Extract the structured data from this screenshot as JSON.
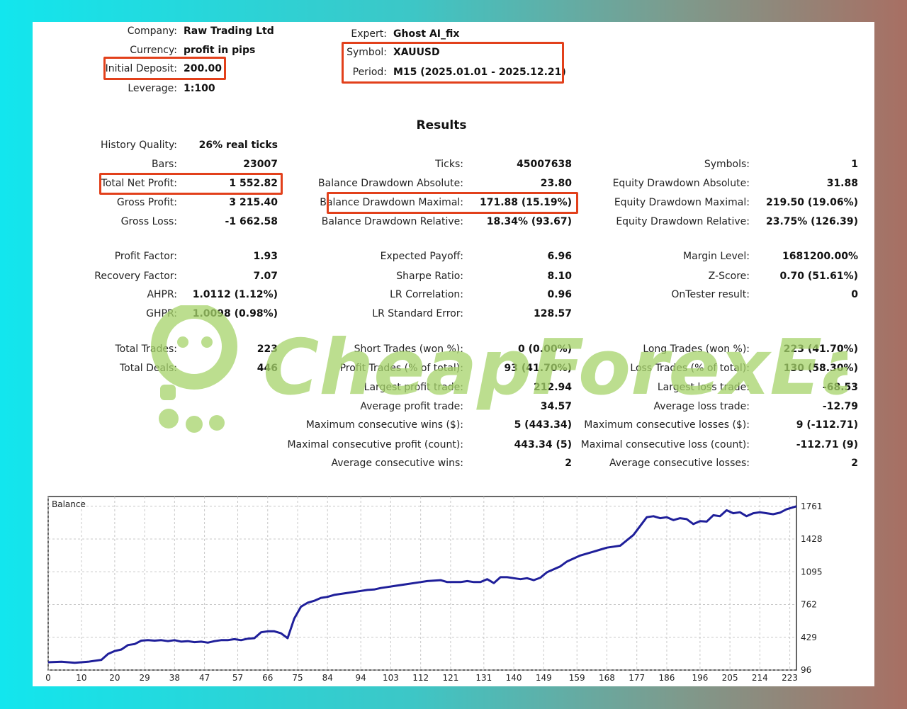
{
  "header": {
    "company_label": "Company:",
    "company_value": "Raw Trading Ltd",
    "currency_label": "Currency:",
    "currency_value": "profit in pips",
    "deposit_label": "Initial Deposit:",
    "deposit_value": "200.00",
    "leverage_label": "Leverage:",
    "leverage_value": "1:100",
    "expert_label": "Expert:",
    "expert_value": "Ghost AI_fix",
    "symbol_label": "Symbol:",
    "symbol_value": "XAUUSD",
    "period_label": "Period:",
    "period_value": "M15 (2025.01.01 - 2025.12.21)"
  },
  "results": {
    "title": "Results",
    "history_quality_label": "History Quality:",
    "history_quality_value": "26% real ticks",
    "bars_label": "Bars:",
    "bars_value": "23007",
    "ticks_label": "Ticks:",
    "ticks_value": "45007638",
    "symbols_label": "Symbols:",
    "symbols_value": "1",
    "net_profit_label": "Total Net Profit:",
    "net_profit_value": "1 552.82",
    "bal_dd_abs_label": "Balance Drawdown Absolute:",
    "bal_dd_abs_value": "23.80",
    "eq_dd_abs_label": "Equity Drawdown Absolute:",
    "eq_dd_abs_value": "31.88",
    "gross_profit_label": "Gross Profit:",
    "gross_profit_value": "3 215.40",
    "bal_dd_max_label": "Balance Drawdown Maximal:",
    "bal_dd_max_value": "171.88 (15.19%)",
    "eq_dd_max_label": "Equity Drawdown Maximal:",
    "eq_dd_max_value": "219.50 (19.06%)",
    "gross_loss_label": "Gross Loss:",
    "gross_loss_value": "-1 662.58",
    "bal_dd_rel_label": "Balance Drawdown Relative:",
    "bal_dd_rel_value": "18.34% (93.67)",
    "eq_dd_rel_label": "Equity Drawdown Relative:",
    "eq_dd_rel_value": "23.75% (126.39)",
    "profit_factor_label": "Profit Factor:",
    "profit_factor_value": "1.93",
    "expected_payoff_label": "Expected Payoff:",
    "expected_payoff_value": "6.96",
    "margin_level_label": "Margin Level:",
    "margin_level_value": "1681200.00%",
    "recovery_factor_label": "Recovery Factor:",
    "recovery_factor_value": "7.07",
    "sharpe_label": "Sharpe Ratio:",
    "sharpe_value": "8.10",
    "zscore_label": "Z-Score:",
    "zscore_value": "0.70 (51.61%)",
    "ahpr_label": "AHPR:",
    "ahpr_value": "1.0112 (1.12%)",
    "lr_corr_label": "LR Correlation:",
    "lr_corr_value": "0.96",
    "ontester_label": "OnTester result:",
    "ontester_value": "0",
    "ghpr_label": "GHPR:",
    "ghpr_value": "1.0098 (0.98%)",
    "lr_se_label": "LR Standard Error:",
    "lr_se_value": "128.57",
    "total_trades_label": "Total Trades:",
    "total_trades_value": "223",
    "short_trades_label": "Short Trades (won %):",
    "short_trades_value": "0 (0.00%)",
    "long_trades_label": "Long Trades (won %):",
    "long_trades_value": "223 (41.70%)",
    "total_deals_label": "Total Deals:",
    "total_deals_value": "446",
    "profit_trades_label": "Profit Trades (% of total):",
    "profit_trades_value": "93 (41.70%)",
    "loss_trades_label": "Loss Trades (% of total):",
    "loss_trades_value": "130 (58.30%)",
    "largest_profit_label": "Largest profit trade:",
    "largest_profit_value": "212.94",
    "largest_loss_label": "Largest loss trade:",
    "largest_loss_value": "-68.53",
    "avg_profit_label": "Average profit trade:",
    "avg_profit_value": "34.57",
    "avg_loss_label": "Average loss trade:",
    "avg_loss_value": "-12.79",
    "max_cons_wins_label": "Maximum consecutive wins ($):",
    "max_cons_wins_value": "5 (443.34)",
    "max_cons_losses_label": "Maximum consecutive losses ($):",
    "max_cons_losses_value": "9 (-112.71)",
    "maximal_cons_profit_label": "Maximal consecutive profit (count):",
    "maximal_cons_profit_value": "443.34 (5)",
    "maximal_cons_loss_label": "Maximal consecutive loss (count):",
    "maximal_cons_loss_value": "-112.71 (9)",
    "avg_cons_wins_label": "Average consecutive wins:",
    "avg_cons_wins_value": "2",
    "avg_cons_losses_label": "Average consecutive losses:",
    "avg_cons_losses_value": "2"
  },
  "watermark": {
    "text": "CheapForexEa"
  },
  "colors": {
    "highlight": "#e2401b",
    "line": "#1f1f9a",
    "watermark": "#a6d46a"
  },
  "chart_data": {
    "type": "line",
    "title": "Balance",
    "xlabel": "",
    "ylabel": "",
    "x_ticks": [
      0,
      10,
      20,
      29,
      38,
      47,
      57,
      66,
      75,
      84,
      94,
      103,
      112,
      121,
      131,
      140,
      149,
      159,
      168,
      177,
      186,
      196,
      205,
      214,
      223
    ],
    "y_ticks": [
      96,
      429,
      762,
      1095,
      1428,
      1761
    ],
    "xlim": [
      0,
      225
    ],
    "ylim": [
      96,
      1860
    ],
    "grid": true,
    "series": [
      {
        "x": [
          0,
          4,
          8,
          12,
          16,
          18,
          20,
          22,
          24,
          26,
          28,
          30,
          32,
          34,
          36,
          38,
          40,
          42,
          44,
          46,
          48,
          50,
          52,
          54,
          56,
          58,
          60,
          62,
          64,
          66,
          68,
          70,
          72,
          74,
          76,
          78,
          80,
          82,
          84,
          86,
          88,
          90,
          92,
          94,
          96,
          98,
          100,
          102,
          104,
          106,
          108,
          110,
          112,
          114,
          116,
          118,
          120,
          122,
          124,
          126,
          128,
          130,
          132,
          134,
          136,
          138,
          140,
          142,
          144,
          146,
          148,
          150,
          152,
          154,
          156,
          158,
          160,
          162,
          164,
          166,
          168,
          170,
          172,
          176,
          178,
          180,
          182,
          184,
          186,
          188,
          190,
          192,
          194,
          196,
          198,
          200,
          202,
          204,
          206,
          208,
          210,
          212,
          214,
          216,
          218,
          220,
          222,
          225
        ],
        "y": [
          175,
          180,
          170,
          180,
          200,
          260,
          290,
          305,
          350,
          360,
          395,
          400,
          395,
          400,
          390,
          400,
          385,
          390,
          380,
          385,
          375,
          390,
          400,
          400,
          410,
          400,
          415,
          420,
          480,
          490,
          490,
          470,
          420,
          620,
          740,
          780,
          800,
          830,
          840,
          860,
          870,
          880,
          890,
          900,
          910,
          915,
          930,
          940,
          950,
          960,
          970,
          980,
          990,
          1000,
          1005,
          1010,
          990,
          990,
          990,
          1000,
          990,
          990,
          1020,
          980,
          1040,
          1040,
          1030,
          1020,
          1030,
          1010,
          1035,
          1090,
          1120,
          1150,
          1200,
          1230,
          1260,
          1280,
          1300,
          1320,
          1340,
          1350,
          1360,
          1470,
          1560,
          1650,
          1660,
          1640,
          1650,
          1620,
          1640,
          1630,
          1580,
          1610,
          1605,
          1670,
          1660,
          1720,
          1690,
          1700,
          1660,
          1690,
          1700,
          1690,
          1680,
          1695,
          1730,
          1761
        ]
      }
    ]
  }
}
